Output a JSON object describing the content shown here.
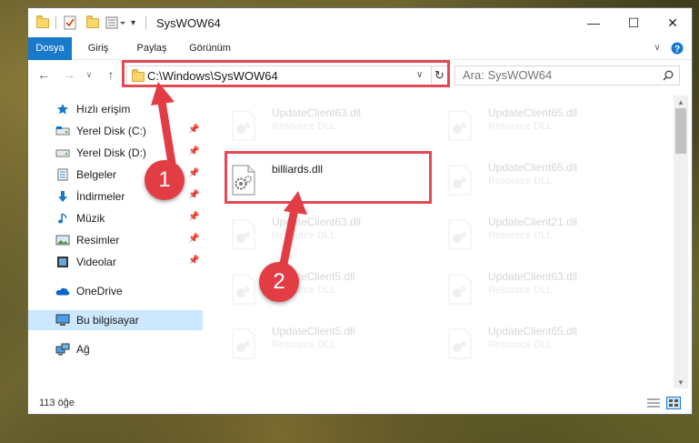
{
  "window": {
    "title": "SysWOW64",
    "minimize_glyph": "—",
    "maximize_glyph": "☐",
    "close_glyph": "✕"
  },
  "ribbon": {
    "tabs": [
      {
        "label": "Dosya",
        "active": true
      },
      {
        "label": "Giriş"
      },
      {
        "label": "Paylaş"
      },
      {
        "label": "Görünüm"
      }
    ]
  },
  "address": {
    "path": "C:\\Windows\\SysWOW64",
    "search_placeholder": "Ara: SysWOW64"
  },
  "nav_pane": {
    "items": [
      {
        "label": "Hızlı erişim",
        "icon": "star-icon"
      },
      {
        "label": "Yerel Disk (C:)",
        "icon": "drive-icon",
        "pinned": true
      },
      {
        "label": "Yerel Disk (D:)",
        "icon": "drive-icon",
        "pinned": true
      },
      {
        "label": "Belgeler",
        "icon": "documents-icon",
        "pinned": true
      },
      {
        "label": "İndirmeler",
        "icon": "download-icon",
        "pinned": true
      },
      {
        "label": "Müzik",
        "icon": "music-icon",
        "pinned": true
      },
      {
        "label": "Resimler",
        "icon": "pictures-icon",
        "pinned": true
      },
      {
        "label": "Videolar",
        "icon": "videos-icon",
        "pinned": true
      },
      {
        "label": "OneDrive",
        "icon": "cloud-icon"
      },
      {
        "label": "Bu bilgisayar",
        "icon": "computer-icon",
        "selected": true
      },
      {
        "label": "Ağ",
        "icon": "network-icon"
      }
    ]
  },
  "files": [
    {
      "name": "UpdateClient63.dll",
      "type": "Resource DLL"
    },
    {
      "name": "UpdateClient65.dll",
      "type": "Resource DLL"
    },
    {
      "name": "billiards.dll",
      "type": ""
    },
    {
      "name": "UpdateClient65.dll",
      "type": "Resource DLL"
    },
    {
      "name": "UpdateClient63.dll",
      "type": "Resource DLL"
    },
    {
      "name": "UpdateClient21.dll",
      "type": "Resource DLL"
    },
    {
      "name": "UpdateClient5.dll",
      "type": "Resource DLL"
    },
    {
      "name": "UpdateClient63.dll",
      "type": "Resource DLL"
    },
    {
      "name": "UpdateClient5.dll",
      "type": "Resource DLL"
    },
    {
      "name": "UpdateClient65.dll",
      "type": "Resource DLL"
    }
  ],
  "status": {
    "item_count": "113 öğe"
  },
  "annotations": {
    "step1": "1",
    "step2": "2",
    "color": "#e23d45"
  }
}
